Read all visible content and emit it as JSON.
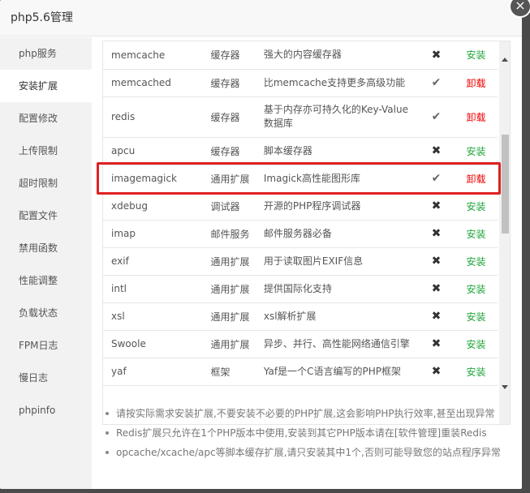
{
  "window": {
    "title": "php5.6管理",
    "close_icon": "×"
  },
  "sidebar": {
    "items": [
      {
        "label": "php服务",
        "active": false
      },
      {
        "label": "安装扩展",
        "active": true
      },
      {
        "label": "配置修改",
        "active": false
      },
      {
        "label": "上传限制",
        "active": false
      },
      {
        "label": "超时限制",
        "active": false
      },
      {
        "label": "配置文件",
        "active": false
      },
      {
        "label": "禁用函数",
        "active": false
      },
      {
        "label": "性能调整",
        "active": false
      },
      {
        "label": "负载状态",
        "active": false
      },
      {
        "label": "FPM日志",
        "active": false
      },
      {
        "label": "慢日志",
        "active": false
      },
      {
        "label": "phpinfo",
        "active": false
      }
    ]
  },
  "extensions": [
    {
      "name": "memcache",
      "type": "缓存器",
      "desc": "强大的内容缓存器",
      "status_icon": "✖",
      "installed": false,
      "action": "安装"
    },
    {
      "name": "memcached",
      "type": "缓存器",
      "desc": "比memcache支持更多高级功能",
      "status_icon": "✔",
      "installed": true,
      "action": "卸载"
    },
    {
      "name": "redis",
      "type": "缓存器",
      "desc": "基于内存亦可持久化的Key-Value数据库",
      "status_icon": "✔",
      "installed": true,
      "action": "卸载"
    },
    {
      "name": "apcu",
      "type": "缓存器",
      "desc": "脚本缓存器",
      "status_icon": "✖",
      "installed": false,
      "action": "安装"
    },
    {
      "name": "imagemagick",
      "type": "通用扩展",
      "desc": "Imagick高性能图形库",
      "status_icon": "✔",
      "installed": true,
      "action": "卸载"
    },
    {
      "name": "xdebug",
      "type": "调试器",
      "desc": "开源的PHP程序调试器",
      "status_icon": "✖",
      "installed": false,
      "action": "安装"
    },
    {
      "name": "imap",
      "type": "邮件服务",
      "desc": "邮件服务器必备",
      "status_icon": "✖",
      "installed": false,
      "action": "安装"
    },
    {
      "name": "exif",
      "type": "通用扩展",
      "desc": "用于读取图片EXIF信息",
      "status_icon": "✖",
      "installed": false,
      "action": "安装"
    },
    {
      "name": "intl",
      "type": "通用扩展",
      "desc": "提供国际化支持",
      "status_icon": "✖",
      "installed": false,
      "action": "安装"
    },
    {
      "name": "xsl",
      "type": "通用扩展",
      "desc": "xsl解析扩展",
      "status_icon": "✖",
      "installed": false,
      "action": "安装"
    },
    {
      "name": "Swoole",
      "type": "通用扩展",
      "desc": "异步、并行、高性能网络通信引擎",
      "status_icon": "✖",
      "installed": false,
      "action": "安装"
    },
    {
      "name": "yaf",
      "type": "框架",
      "desc": "Yaf是一个C语言编写的PHP框架",
      "status_icon": "✖",
      "installed": false,
      "action": "安装"
    }
  ],
  "notes": [
    "请按实际需求安装扩展,不要安装不必要的PHP扩展,这会影响PHP执行效率,甚至出现异常",
    "Redis扩展只允许在1个PHP版本中使用,安装到其它PHP版本请在[软件管理]重装Redis",
    "opcache/xcache/apc等脚本缓存扩展,请只安装其中1个,否则可能导致您的站点程序异常"
  ],
  "colors": {
    "install": "#20a53a",
    "uninstall": "#ee0000",
    "highlight": "#e02020"
  }
}
